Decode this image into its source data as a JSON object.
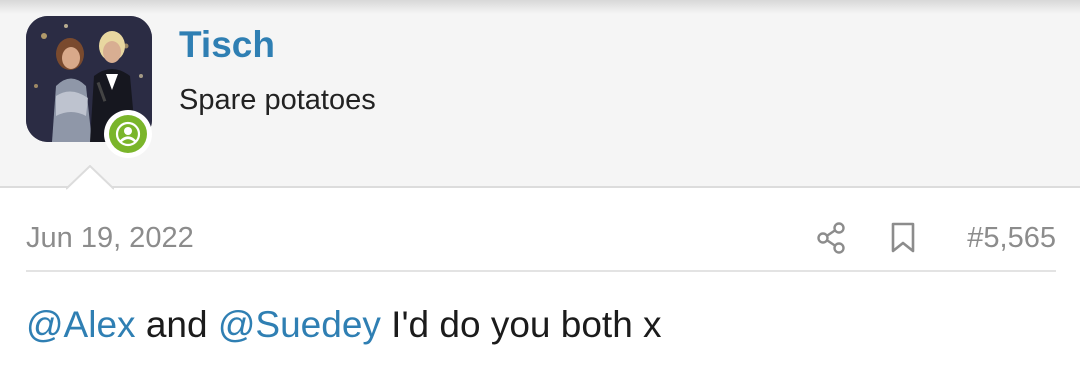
{
  "user": {
    "name": "Tisch",
    "title": "Spare potatoes",
    "avatar_icon": "user-avatar-photo",
    "online_icon": "online-status-user-icon"
  },
  "message": {
    "date": "Jun 19, 2022",
    "post_number": "#5,565",
    "share_icon": "share-icon",
    "bookmark_icon": "bookmark-icon",
    "body": {
      "mention_1": "@Alex",
      "text_1": " and ",
      "mention_2": "@Suedey",
      "text_2": " I'd do you both x"
    }
  },
  "colors": {
    "link": "#2f7fb3",
    "muted": "#8c8c8c",
    "online": "#7ab52a",
    "header_bg": "#f5f5f5"
  }
}
